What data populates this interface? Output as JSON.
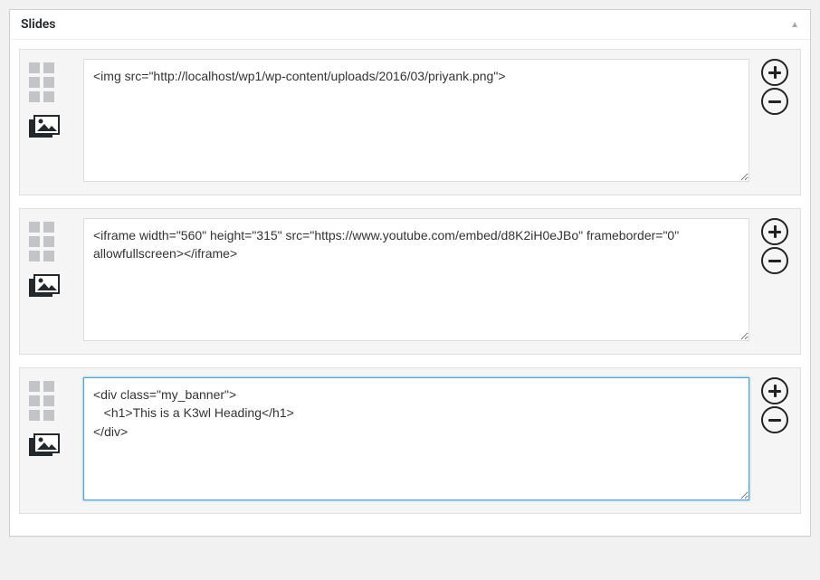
{
  "panel": {
    "title": "Slides"
  },
  "slides": [
    {
      "content": "<img src=\"http://localhost/wp1/wp-content/uploads/2016/03/priyank.png\">",
      "focused": false
    },
    {
      "content": "<iframe width=\"560\" height=\"315\" src=\"https://www.youtube.com/embed/d8K2iH0eJBo\" frameborder=\"0\" allowfullscreen></iframe>",
      "focused": false
    },
    {
      "content": "<div class=\"my_banner\">\n   <h1>This is a K3wl Heading</h1>\n</div>",
      "focused": true
    }
  ]
}
